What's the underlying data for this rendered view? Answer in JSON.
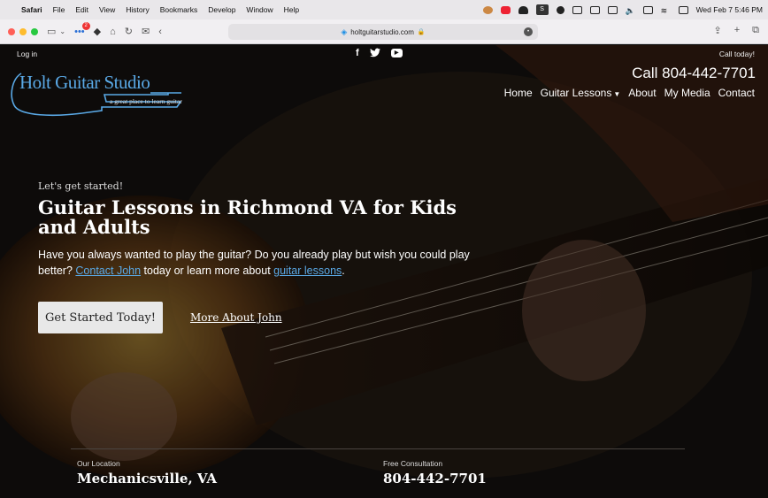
{
  "menubar": {
    "apple": "",
    "items": [
      "Safari",
      "File",
      "Edit",
      "View",
      "History",
      "Bookmarks",
      "Develop",
      "Window",
      "Help"
    ],
    "clock": "Wed Feb 7  5:46 PM"
  },
  "browser": {
    "url": "holtguitarstudio.com",
    "badge_count": "2"
  },
  "site": {
    "login": "Log in",
    "call_today": "Call today!",
    "phone_header": "Call 804-442-7701",
    "logo_title": "Holt Guitar Studio",
    "logo_tagline": "a great place to learn guitar",
    "nav": [
      "Home",
      "Guitar Lessons",
      "About",
      "My Media",
      "Contact"
    ],
    "social": {
      "facebook": "f",
      "twitter": "🐦",
      "youtube": "▶"
    }
  },
  "hero": {
    "eyebrow": "Let's get started!",
    "headline": "Guitar Lessons in Richmond VA for Kids and Adults",
    "lead_1": "Have you always wanted to play the guitar? Do you already play but wish you could play better? ",
    "lead_link_1": "Contact John",
    "lead_2": " today or learn more about ",
    "lead_link_2": "guitar lessons",
    "lead_3": ".",
    "cta": "Get Started Today!",
    "more": "More About John"
  },
  "info": {
    "location_label": "Our Location",
    "location_value": "Mechanicsville, VA",
    "consult_label": "Free Consultation",
    "consult_value": "804-442-7701"
  }
}
